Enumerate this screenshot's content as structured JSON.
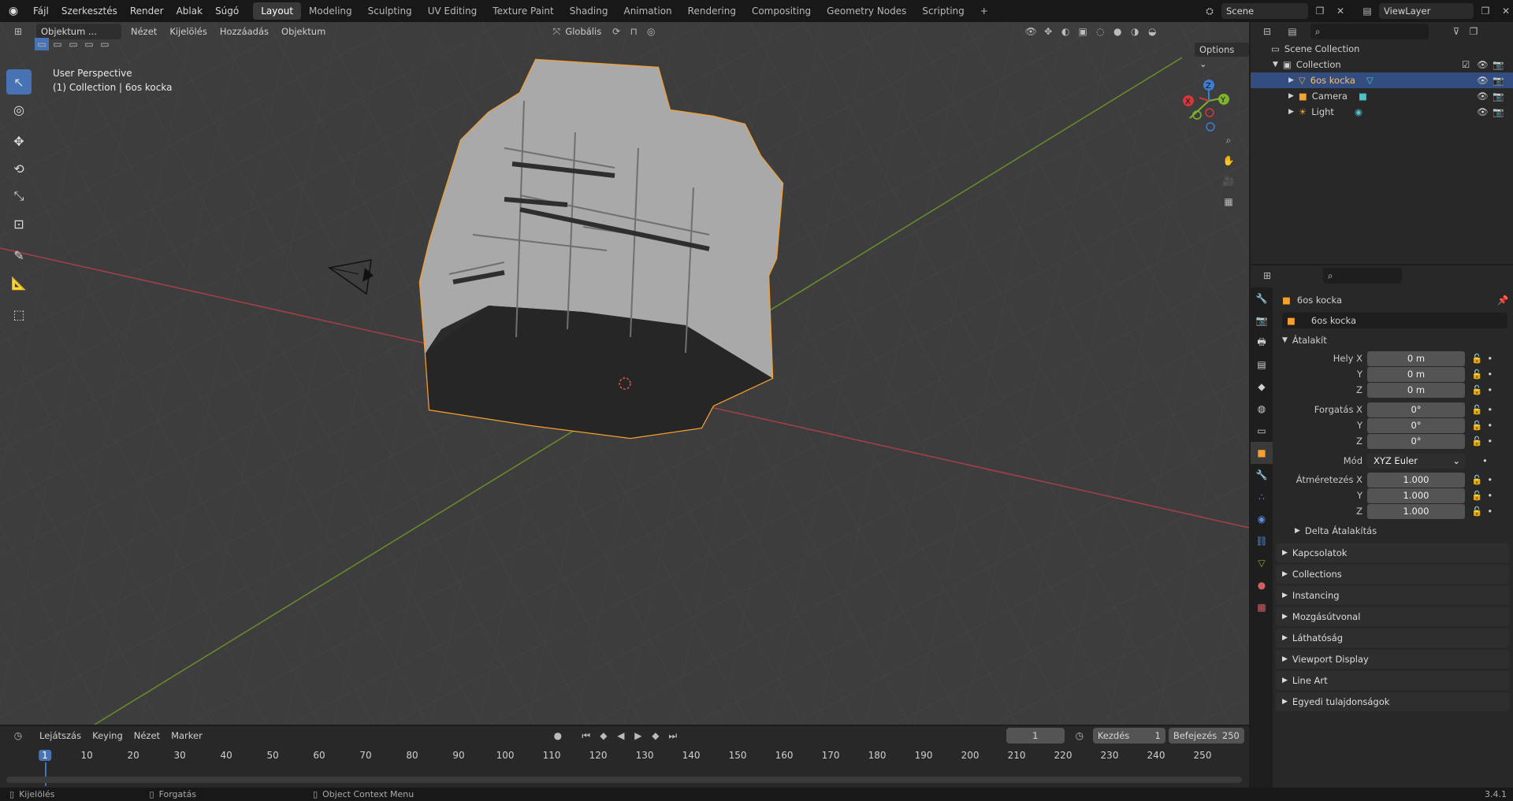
{
  "topbar": {
    "menus": [
      "Fájl",
      "Szerkesztés",
      "Render",
      "Ablak",
      "Súgó"
    ],
    "workspaces": [
      "Layout",
      "Modeling",
      "Sculpting",
      "UV Editing",
      "Texture Paint",
      "Shading",
      "Animation",
      "Rendering",
      "Compositing",
      "Geometry Nodes",
      "Scripting"
    ],
    "active_workspace": "Layout",
    "add_tab": "+",
    "scene": "Scene",
    "view_layer": "ViewLayer"
  },
  "viewport": {
    "mode": "Objektum ...",
    "menus": [
      "Nézet",
      "Kijelölés",
      "Hozzáadás",
      "Objektum"
    ],
    "orientation": "Globális",
    "options": "Options",
    "overlay_title": "User Perspective",
    "overlay_sub": "(1) Collection | 6os kocka",
    "gizmo": {
      "x": "X",
      "y": "Y",
      "z": "Z"
    },
    "colors": {
      "selection": "#f5a030",
      "x_axis": "#d0383d",
      "y_axis": "#7fb22c",
      "bg": "#3d3d3d"
    }
  },
  "outliner": {
    "root": "Scene Collection",
    "collection": "Collection",
    "items": [
      "6os kocka",
      "Camera",
      "Light"
    ]
  },
  "properties": {
    "object_title": "6os kocka",
    "object_name": "6os kocka",
    "transform_header": "Átalakít",
    "loc_label": "Hely X",
    "rot_label": "Forgatás X",
    "scale_label": "Átméretezés X",
    "y": "Y",
    "z": "Z",
    "loc": [
      "0 m",
      "0 m",
      "0 m"
    ],
    "rot": [
      "0°",
      "0°",
      "0°"
    ],
    "mode_label": "Mód",
    "mode_value": "XYZ Euler",
    "scale": [
      "1.000",
      "1.000",
      "1.000"
    ],
    "delta": "Delta Átalakítás",
    "sections": [
      "Kapcsolatok",
      "Collections",
      "Instancing",
      "Mozgásútvonal",
      "Láthatóság",
      "Viewport Display",
      "Line Art",
      "Egyedi tulajdonságok"
    ]
  },
  "timeline": {
    "menus": [
      "Lejátszás",
      "Keying",
      "Nézet",
      "Marker"
    ],
    "current_frame": "1",
    "start_label": "Kezdés",
    "start": "1",
    "end_label": "Befejezés",
    "end": "250",
    "ticks": [
      "1",
      "10",
      "20",
      "30",
      "40",
      "50",
      "60",
      "70",
      "80",
      "90",
      "100",
      "110",
      "120",
      "130",
      "140",
      "150",
      "160",
      "170",
      "180",
      "190",
      "200",
      "210",
      "220",
      "230",
      "240",
      "250"
    ]
  },
  "status": {
    "select": "Kijelölés",
    "rotate": "Forgatás",
    "context": "Object Context Menu",
    "version": "3.4.1"
  }
}
